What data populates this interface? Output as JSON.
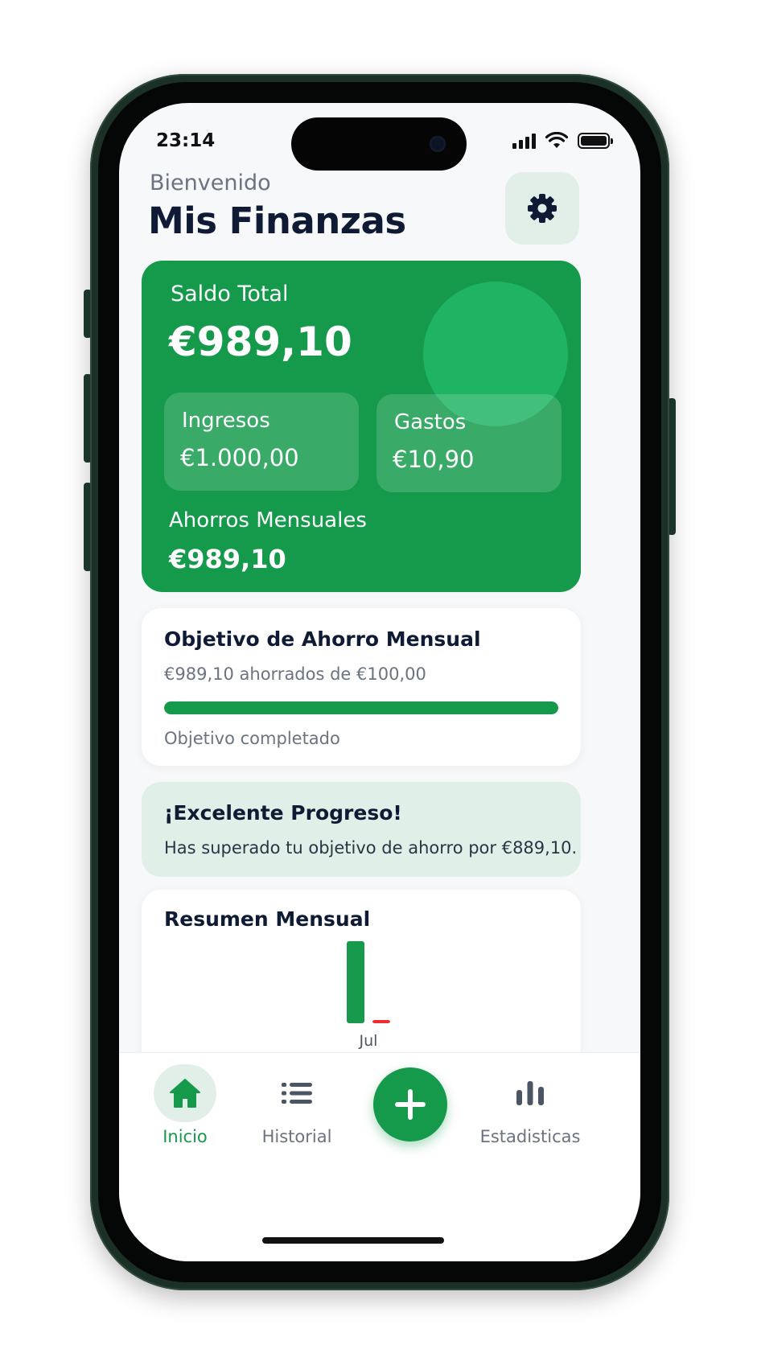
{
  "status_bar": {
    "time": "23:14"
  },
  "header": {
    "greeting": "Bienvenido",
    "title": "Mis Finanzas",
    "settings_icon": "gear-icon"
  },
  "balance_card": {
    "label": "Saldo Total",
    "value": "€989,10",
    "income": {
      "label": "Ingresos",
      "value": "€1.000,00"
    },
    "expenses": {
      "label": "Gastos",
      "value": "€10,90"
    },
    "savings": {
      "label": "Ahorros Mensuales",
      "value": "€989,10"
    },
    "color": "#159a4c"
  },
  "goal_card": {
    "title": "Objetivo de Ahorro Mensual",
    "subtitle": "€989,10 ahorrados de €100,00",
    "progress_percent": 100,
    "status": "Objetivo completado"
  },
  "alert_card": {
    "title": "¡Excelente Progreso!",
    "text": "Has superado tu objetivo de ahorro por €889,10."
  },
  "summary_card": {
    "title": "Resumen Mensual"
  },
  "chart_data": {
    "type": "bar",
    "categories": [
      "Jul"
    ],
    "series": [
      {
        "values": [
          1000.0
        ],
        "color": "#179a4b"
      },
      {
        "values": [
          10.9
        ],
        "color": "#ef2b2b"
      }
    ]
  },
  "bottom_nav": {
    "items": [
      {
        "label": "Inicio",
        "icon": "home-icon",
        "active": true
      },
      {
        "label": "Historial",
        "icon": "list-icon",
        "active": false
      },
      {
        "label": "Estadisticas",
        "icon": "bar-chart-icon",
        "active": false
      }
    ],
    "fab_icon": "plus-icon"
  },
  "colors": {
    "accent": "#159a4c",
    "title": "#0f1b35",
    "muted": "#6b7280",
    "expense": "#ef2b2b"
  }
}
